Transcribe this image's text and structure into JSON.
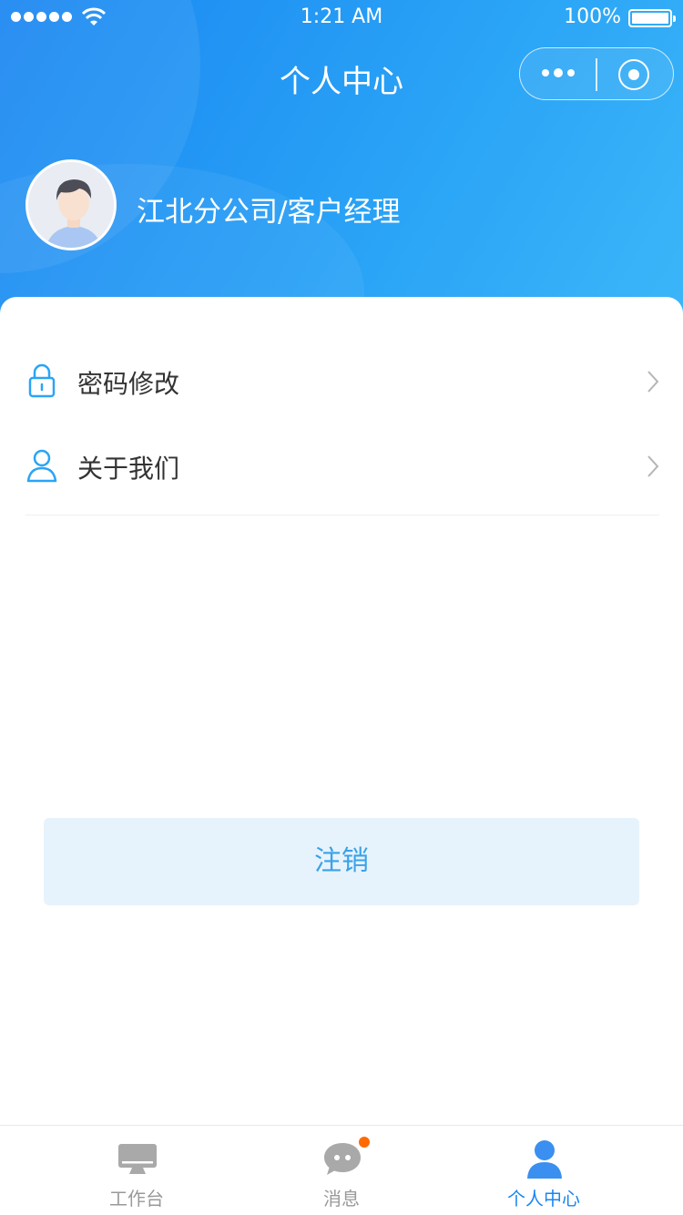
{
  "status_bar": {
    "time": "1:21 AM",
    "battery": "100%",
    "signal_icon": "signal-dots-icon",
    "wifi_icon": "wifi-icon"
  },
  "nav": {
    "title": "个人中心",
    "capsule": {
      "more_icon": "more-dots-icon",
      "close_icon": "miniprogram-close-icon"
    }
  },
  "profile": {
    "avatar_icon": "user-avatar",
    "name": "江北分公司/客户经理"
  },
  "menu": {
    "items": [
      {
        "label": "密码修改",
        "icon": "lock-icon"
      },
      {
        "label": "关于我们",
        "icon": "person-outline-icon"
      }
    ]
  },
  "logout": {
    "label": "注销"
  },
  "tabbar": {
    "tabs": [
      {
        "label": "工作台",
        "icon": "desktop-icon",
        "active": false
      },
      {
        "label": "消息",
        "icon": "chat-bubble-icon",
        "active": false,
        "has_badge": true
      },
      {
        "label": "个人中心",
        "icon": "person-icon",
        "active": true
      }
    ]
  },
  "colors": {
    "header_gradient_start": "#1a86f2",
    "header_gradient_end": "#3cb6f8",
    "accent": "#1a86f2",
    "logout_bg": "#e7f3fc",
    "logout_text": "#3aa2e8",
    "badge": "#ff6a00",
    "icon_blue": "#2aa4f6"
  }
}
